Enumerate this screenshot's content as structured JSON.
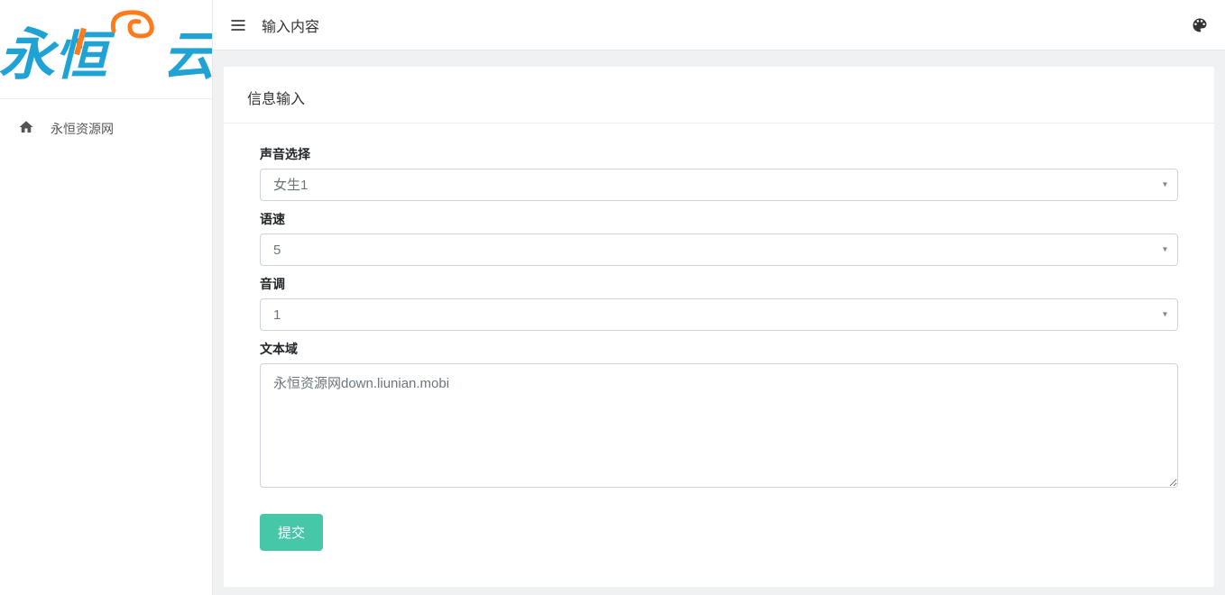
{
  "logo": {
    "char1": "永",
    "char2": "恒",
    "char3": "云"
  },
  "sidebar": {
    "items": [
      {
        "label": "永恒资源网"
      }
    ]
  },
  "topbar": {
    "title": "输入内容"
  },
  "card": {
    "header": "信息输入"
  },
  "form": {
    "voice": {
      "label": "声音选择",
      "value": "女生1"
    },
    "speed": {
      "label": "语速",
      "value": "5"
    },
    "pitch": {
      "label": "音调",
      "value": "1"
    },
    "textarea": {
      "label": "文本域",
      "placeholder": "永恒资源网down.liunian.mobi"
    },
    "submit_label": "提交"
  }
}
